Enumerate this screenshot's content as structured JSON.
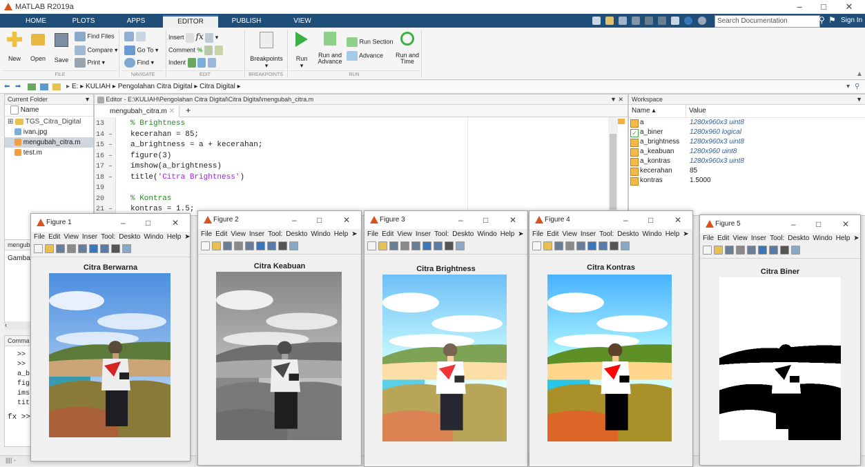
{
  "app": {
    "title": "MATLAB R2019a"
  },
  "tabs": [
    "HOME",
    "PLOTS",
    "APPS",
    "EDITOR",
    "PUBLISH",
    "VIEW"
  ],
  "search": {
    "placeholder": "Search Documentation"
  },
  "sign_in": "Sign In",
  "ribbon": {
    "new": "New",
    "open": "Open",
    "save": "Save",
    "find_files": "Find Files",
    "compare": "Compare",
    "print": "Print",
    "go_to": "Go To",
    "find": "Find",
    "insert": "Insert",
    "comment": "Comment",
    "indent": "Indent",
    "breakpoints": "Breakpoints",
    "run": "Run",
    "run_and_advance": "Run and Advance",
    "run_section": "Run Section",
    "advance": "Advance",
    "run_and_time": "Run and Time",
    "groups": {
      "file": "FILE",
      "navigate": "NAVIGATE",
      "edit": "EDIT",
      "breakpoints": "BREAKPOINTS",
      "run": "RUN"
    }
  },
  "address": [
    "E:",
    "KULIAH",
    "Pengolahan Citra Digital",
    "Citra Digital"
  ],
  "current_folder": {
    "title": "Current Folder",
    "column": "Name",
    "items": [
      "TGS_Citra_Digital",
      "ivan.jpg",
      "mengubah_citra.m",
      "test.m"
    ]
  },
  "editor": {
    "title": "Editor - E:\\KULIAH\\Pengolahan Citra Digital\\Citra Digital\\mengubah_citra.m",
    "tab": "mengubah_citra.m",
    "lines": [
      {
        "n": "13",
        "code": "% Brightness",
        "type": "comment"
      },
      {
        "n": "14 –",
        "code": "kecerahan = 85;",
        "type": "code"
      },
      {
        "n": "15 –",
        "code": "a_brightness = a + kecerahan;",
        "type": "code"
      },
      {
        "n": "16 –",
        "code": "figure(3)",
        "type": "code"
      },
      {
        "n": "17 –",
        "code": "imshow(a_brightness)",
        "type": "code"
      },
      {
        "n": "18 –",
        "code": "title('Citra Brightness')",
        "type": "string"
      },
      {
        "n": "19",
        "code": "",
        "type": "code"
      },
      {
        "n": "20",
        "code": "% Kontras",
        "type": "comment"
      },
      {
        "n": "21 –",
        "code": "kontras = 1.5;",
        "type": "code"
      }
    ]
  },
  "workspace": {
    "title": "Workspace",
    "columns": [
      "Name",
      "Value"
    ],
    "rows": [
      {
        "name": "a",
        "value": "1280x960x3 uint8"
      },
      {
        "name": "a_biner",
        "value": "1280x960 logical"
      },
      {
        "name": "a_brightness",
        "value": "1280x960x3 uint8"
      },
      {
        "name": "a_keabuan",
        "value": "1280x960 uint8"
      },
      {
        "name": "a_kontras",
        "value": "1280x960x3 uint8"
      },
      {
        "name": "kecerahan",
        "value": "85"
      },
      {
        "name": "kontras",
        "value": "1.5000"
      }
    ]
  },
  "details": {
    "file": "mengub",
    "text": "Gamba"
  },
  "command_window": {
    "title": "Comma",
    "lines": [
      ">>",
      ">>",
      "a_b",
      "fig",
      "ims",
      "tit"
    ],
    "prompt": "fx >>"
  },
  "figures": [
    {
      "title": "Figure 1",
      "caption": "Citra Berwarna",
      "filter": "none"
    },
    {
      "title": "Figure 2",
      "caption": "Citra Keabuan",
      "filter": "gray"
    },
    {
      "title": "Figure 3",
      "caption": "Citra Brightness",
      "filter": "bright"
    },
    {
      "title": "Figure 4",
      "caption": "Citra Kontras",
      "filter": "contrast"
    },
    {
      "title": "Figure 5",
      "caption": "Citra Biner",
      "filter": "binary"
    }
  ],
  "figure_menu": {
    "items": [
      "File",
      "Edit",
      "View",
      "Insert",
      "Tools",
      "Desktop",
      "Window",
      "Help"
    ],
    "shown": [
      "File",
      "Edit",
      "View",
      "Inser",
      "Tool:",
      "Deskto",
      "Windo",
      "Help"
    ]
  }
}
